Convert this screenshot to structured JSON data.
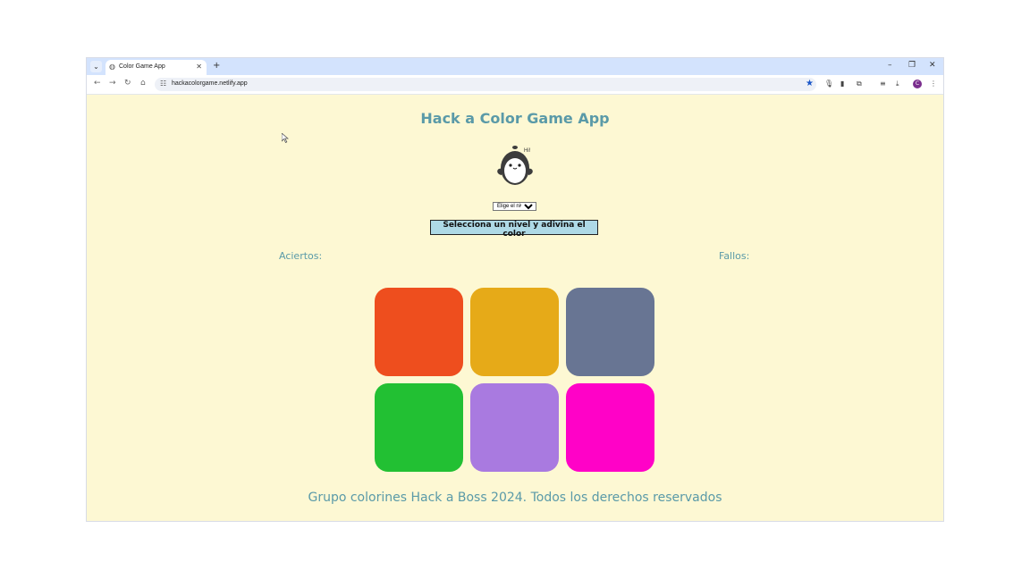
{
  "browser": {
    "tab_title": "Color Game App",
    "url": "hackacolorgame.netlify.app",
    "profile_initial": "C"
  },
  "app": {
    "title": "Hack a Color Game App",
    "mascot_bubble": "Hi!",
    "level_select": {
      "selected": "Elige el nivel"
    },
    "start_button": "Selecciona un nivel y adivina el color",
    "aciertos_label": "Aciertos:",
    "fallos_label": "Fallos:",
    "tiles": [
      {
        "color": "#ee4e1e"
      },
      {
        "color": "#e6aa18"
      },
      {
        "color": "#687593"
      },
      {
        "color": "#22c033"
      },
      {
        "color": "#a97ae0"
      },
      {
        "color": "#ff02c7"
      }
    ],
    "footer": "Grupo colorines Hack a Boss 2024. Todos los derechos reservados"
  }
}
